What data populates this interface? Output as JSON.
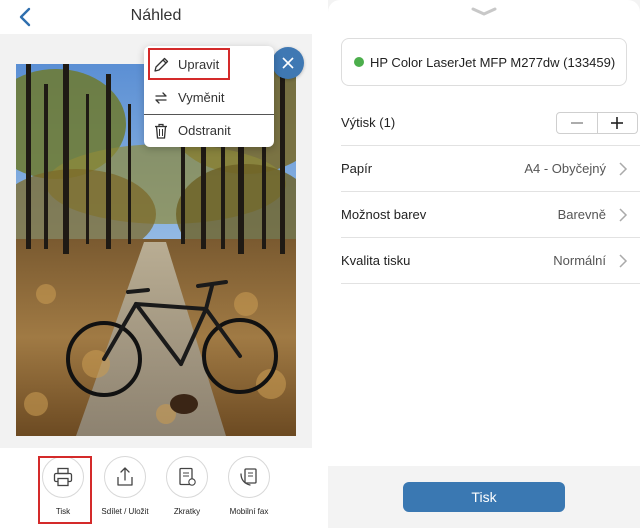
{
  "left": {
    "title": "Náhled",
    "menu": {
      "edit_label": "Upravit",
      "replace_label": "Vyměnit",
      "remove_label": "Odstranit"
    },
    "toolbar": {
      "print_label": "Tisk",
      "share_label": "Sdílet / Uložit",
      "shortcuts_label": "Zkratky",
      "fax_label": "Mobilní fax"
    }
  },
  "right": {
    "printer": {
      "name": "HP Color LaserJet MFP M277dw (133459)",
      "status_color": "#4cae4c"
    },
    "copies": {
      "label": "Výtisk (1)"
    },
    "settings": [
      {
        "label": "Papír",
        "value": "A4 - Obyčejný"
      },
      {
        "label": "Možnost barev",
        "value": "Barevně"
      },
      {
        "label": "Kvalita tisku",
        "value": "Normální"
      }
    ],
    "print_button": "Tisk"
  },
  "colors": {
    "accent": "#3a78b2",
    "highlight": "#d42a2a"
  }
}
